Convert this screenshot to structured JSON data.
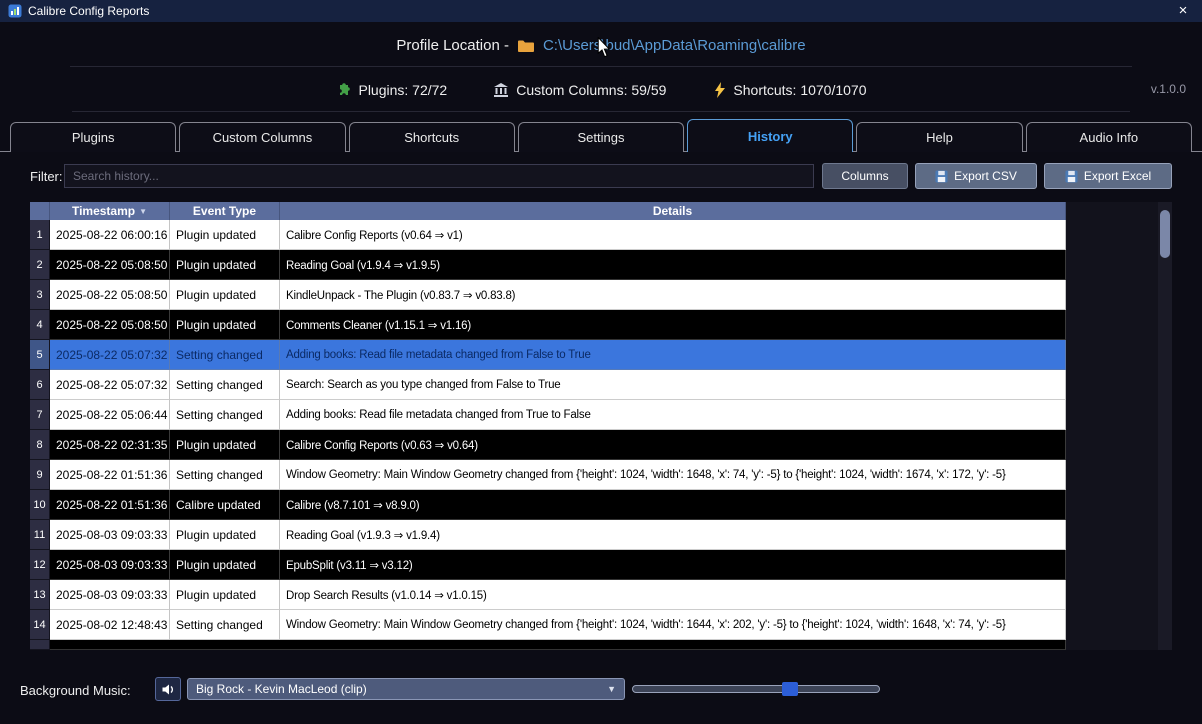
{
  "window": {
    "title": "Calibre Config Reports",
    "close_glyph": "×"
  },
  "header": {
    "profile_label": "Profile Location -",
    "profile_path": "C:\\Users\\bud\\AppData\\Roaming\\calibre",
    "stats": [
      {
        "icon": "puzzle-icon",
        "label": "Plugins: 72/72"
      },
      {
        "icon": "bank-icon",
        "label": "Custom Columns: 59/59"
      },
      {
        "icon": "lightning-icon",
        "label": "Shortcuts: 1070/1070"
      }
    ],
    "version": "v.1.0.0"
  },
  "tabs": [
    {
      "label": "Plugins",
      "active": false
    },
    {
      "label": "Custom Columns",
      "active": false
    },
    {
      "label": "Shortcuts",
      "active": false
    },
    {
      "label": "Settings",
      "active": false
    },
    {
      "label": "History",
      "active": true
    },
    {
      "label": "Help",
      "active": false
    },
    {
      "label": "Audio Info",
      "active": false
    }
  ],
  "filter": {
    "label": "Filter:",
    "placeholder": "Search history...",
    "columns_button": "Columns",
    "export_csv_button": "Export CSV",
    "export_excel_button": "Export Excel"
  },
  "table": {
    "columns": {
      "timestamp": "Timestamp",
      "event_type": "Event Type",
      "details": "Details"
    },
    "sort_indicator": "▼",
    "rows": [
      {
        "num": "1",
        "timestamp": "2025-08-22 06:00:16",
        "event": "Plugin updated",
        "details": "Calibre Config Reports (v0.64 ⇒ v1)",
        "stripe": "light"
      },
      {
        "num": "2",
        "timestamp": "2025-08-22 05:08:50",
        "event": "Plugin updated",
        "details": "Reading Goal (v1.9.4 ⇒ v1.9.5)",
        "stripe": "dark"
      },
      {
        "num": "3",
        "timestamp": "2025-08-22 05:08:50",
        "event": "Plugin updated",
        "details": "KindleUnpack - The Plugin (v0.83.7 ⇒ v0.83.8)",
        "stripe": "light"
      },
      {
        "num": "4",
        "timestamp": "2025-08-22 05:08:50",
        "event": "Plugin updated",
        "details": "Comments Cleaner (v1.15.1 ⇒ v1.16)",
        "stripe": "dark"
      },
      {
        "num": "5",
        "timestamp": "2025-08-22 05:07:32",
        "event": "Setting changed",
        "details": "Adding books: Read file metadata changed from False to True",
        "stripe": "selected"
      },
      {
        "num": "6",
        "timestamp": "2025-08-22 05:07:32",
        "event": "Setting changed",
        "details": "Search: Search as you type changed from False to True",
        "stripe": "light"
      },
      {
        "num": "7",
        "timestamp": "2025-08-22 05:06:44",
        "event": "Setting changed",
        "details": "Adding books: Read file metadata changed from True to False",
        "stripe": "light"
      },
      {
        "num": "8",
        "timestamp": "2025-08-22 02:31:35",
        "event": "Plugin updated",
        "details": "Calibre Config Reports (v0.63 ⇒ v0.64)",
        "stripe": "dark"
      },
      {
        "num": "9",
        "timestamp": "2025-08-22 01:51:36",
        "event": "Setting changed",
        "details": "Window Geometry: Main Window Geometry changed from {'height': 1024, 'width': 1648, 'x': 74, 'y': -5} to {'height': 1024, 'width': 1674, 'x': 172, 'y': -5}",
        "stripe": "light"
      },
      {
        "num": "10",
        "timestamp": "2025-08-22 01:51:36",
        "event": "Calibre updated",
        "details": "Calibre (v8.7.101 ⇒ v8.9.0)",
        "stripe": "dark"
      },
      {
        "num": "11",
        "timestamp": "2025-08-03 09:03:33",
        "event": "Plugin updated",
        "details": "Reading Goal (v1.9.3 ⇒ v1.9.4)",
        "stripe": "light"
      },
      {
        "num": "12",
        "timestamp": "2025-08-03 09:03:33",
        "event": "Plugin updated",
        "details": "EpubSplit (v3.11 ⇒ v3.12)",
        "stripe": "dark"
      },
      {
        "num": "13",
        "timestamp": "2025-08-03 09:03:33",
        "event": "Plugin updated",
        "details": "Drop Search Results (v1.0.14 ⇒ v1.0.15)",
        "stripe": "light"
      },
      {
        "num": "14",
        "timestamp": "2025-08-02 12:48:43",
        "event": "Setting changed",
        "details": "Window Geometry: Main Window Geometry changed from {'height': 1024, 'width': 1644, 'x': 202, 'y': -5} to {'height': 1024, 'width': 1648, 'x': 74, 'y': -5}",
        "stripe": "light"
      }
    ]
  },
  "footer": {
    "label": "Background Music:",
    "selected_track": "Big Rock - Kevin MacLeod (clip)",
    "volume_percent": 64
  },
  "colors": {
    "accent_blue": "#45a1f5",
    "link": "#5b9bd5",
    "table_header_bg": "#5b6d9d",
    "selected_row_bg": "#3b76dd",
    "titlebar_bg": "#162240"
  }
}
